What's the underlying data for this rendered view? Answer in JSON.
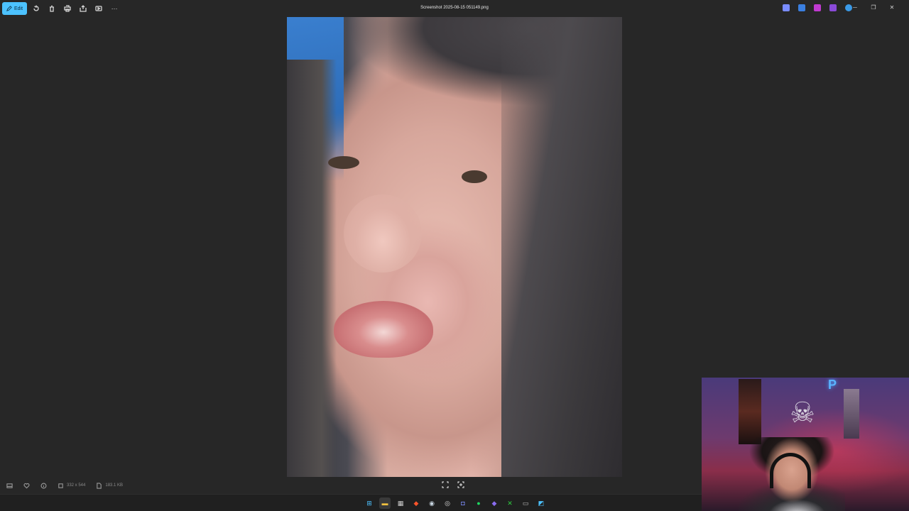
{
  "window": {
    "title": "Screenshot 2025-08-15 051149.png"
  },
  "toolbar": {
    "edit_label": "Edit",
    "icons": [
      "rotate-icon",
      "delete-icon",
      "print-icon",
      "share-icon",
      "slideshow-icon",
      "more-icon"
    ],
    "more_label": "···"
  },
  "titlebar_right": {
    "app_icons": [
      {
        "name": "copilot-icon",
        "color": "#7a8cff"
      },
      {
        "name": "designer-icon",
        "color": "#3a7fe0"
      },
      {
        "name": "clipchamp-icon",
        "color": "#c03ad0"
      },
      {
        "name": "onenote-icon",
        "color": "#8a4ad8"
      },
      {
        "name": "onedrive-icon",
        "color": "#3a9ae8"
      }
    ],
    "minimize": "─",
    "restore": "❐",
    "close": "✕"
  },
  "infobar": {
    "dimensions": "332 x 544",
    "file_size": "183.1 KB"
  },
  "taskbar": {
    "apps": [
      {
        "name": "windows-start-icon",
        "color": "#4cc2ff",
        "glyph": "⊞"
      },
      {
        "name": "file-explorer-icon",
        "color": "#f0c040",
        "glyph": "▬"
      },
      {
        "name": "calendar-app-icon",
        "color": "#cfcfcf",
        "glyph": "▦"
      },
      {
        "name": "brave-browser-icon",
        "color": "#fb542b",
        "glyph": "◆"
      },
      {
        "name": "steam-icon",
        "color": "#c7d5e0",
        "glyph": "◉"
      },
      {
        "name": "chrome-icon",
        "color": "#dddddd",
        "glyph": "◎"
      },
      {
        "name": "discord-icon",
        "color": "#7c8cf8",
        "glyph": "◘"
      },
      {
        "name": "spotify-icon",
        "color": "#1ed760",
        "glyph": "●"
      },
      {
        "name": "proton-icon",
        "color": "#8a6cf0",
        "glyph": "◆"
      },
      {
        "name": "xbox-icon",
        "color": "#2ecc40",
        "glyph": "✕"
      },
      {
        "name": "terminal-icon",
        "color": "#bbbbbb",
        "glyph": "▭"
      },
      {
        "name": "photos-app-icon",
        "color": "#4cc2ff",
        "glyph": "◩"
      }
    ]
  }
}
